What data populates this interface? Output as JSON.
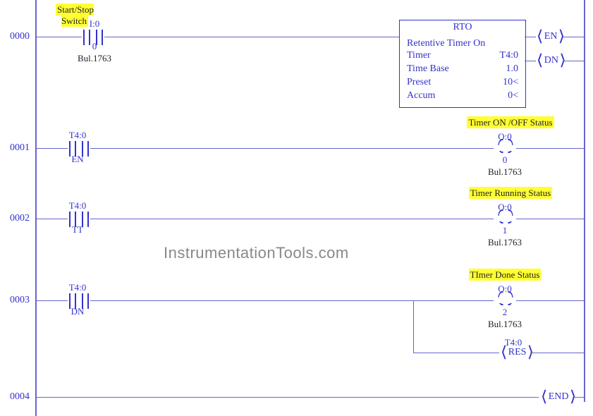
{
  "rungs": [
    "0000",
    "0001",
    "0002",
    "0003",
    "0004"
  ],
  "rung0": {
    "title": "Start/Stop Switch",
    "address": "I:0",
    "bit": "0",
    "module": "Bul.1763",
    "timer": {
      "title": "RTO",
      "line1": "Retentive Timer On",
      "timer_label": "Timer",
      "timer_val": "T4:0",
      "timebase_label": "Time Base",
      "timebase_val": "1.0",
      "preset_label": "Preset",
      "preset_val": "10<",
      "accum_label": "Accum",
      "accum_val": "0<"
    },
    "en": "EN",
    "dn": "DN"
  },
  "rung1": {
    "xic_top": "T4:0",
    "xic_bot": "EN",
    "title": "Timer ON /OFF Status",
    "out_addr": "O:0",
    "out_bit": "0",
    "out_mod": "Bul.1763"
  },
  "rung2": {
    "xic_top": "T4:0",
    "xic_bot": "TT",
    "title": "Timer Running Status",
    "out_addr": "O:0",
    "out_bit": "1",
    "out_mod": "Bul.1763"
  },
  "rung3": {
    "xic_top": "T4:0",
    "xic_bot": "DN",
    "title": "TImer Done Status",
    "out_addr": "O:0",
    "out_bit": "2",
    "out_mod": "Bul.1763",
    "res_addr": "T4:0",
    "res": "RES"
  },
  "end": "END",
  "watermark": "InstrumentationTools.com"
}
